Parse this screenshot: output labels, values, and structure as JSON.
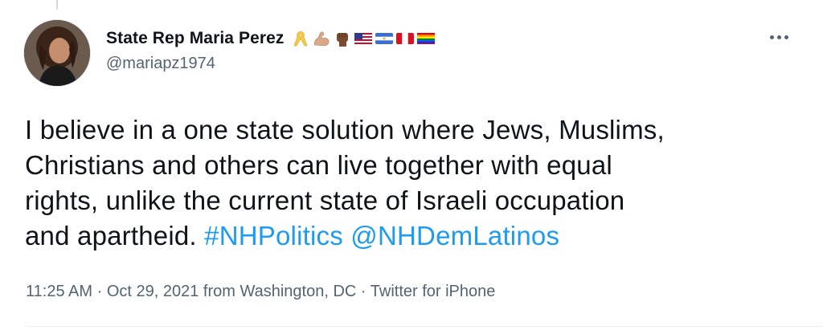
{
  "tweet": {
    "author": {
      "display_name": "State Rep Maria Perez",
      "handle": "@mariapz1974",
      "name_emojis": [
        "yellow-ribbon-icon",
        "flexed-biceps-icon",
        "raised-fist-icon",
        "us-flag-icon",
        "nicaragua-flag-icon",
        "peru-flag-icon",
        "rainbow-flag-icon"
      ]
    },
    "text_parts": {
      "line1": "I believe in a one state solution where Jews, Muslims,",
      "line2": "Christians and others can live together with equal",
      "line3": "rights, unlike the current state of Israeli occupation",
      "line4": "and apartheid. ",
      "hashtag": "#NHPolitics",
      "mention": "@NHDemLatinos"
    },
    "meta": {
      "time": "11:25 AM",
      "sep1": " · ",
      "date": "Oct 29, 2021",
      "location": " from Washington, DC",
      "sep2": " · ",
      "source": "Twitter for iPhone"
    }
  },
  "colors": {
    "link": "#1d9bf0",
    "secondary_text": "#536471",
    "primary_text": "#0f1419"
  }
}
